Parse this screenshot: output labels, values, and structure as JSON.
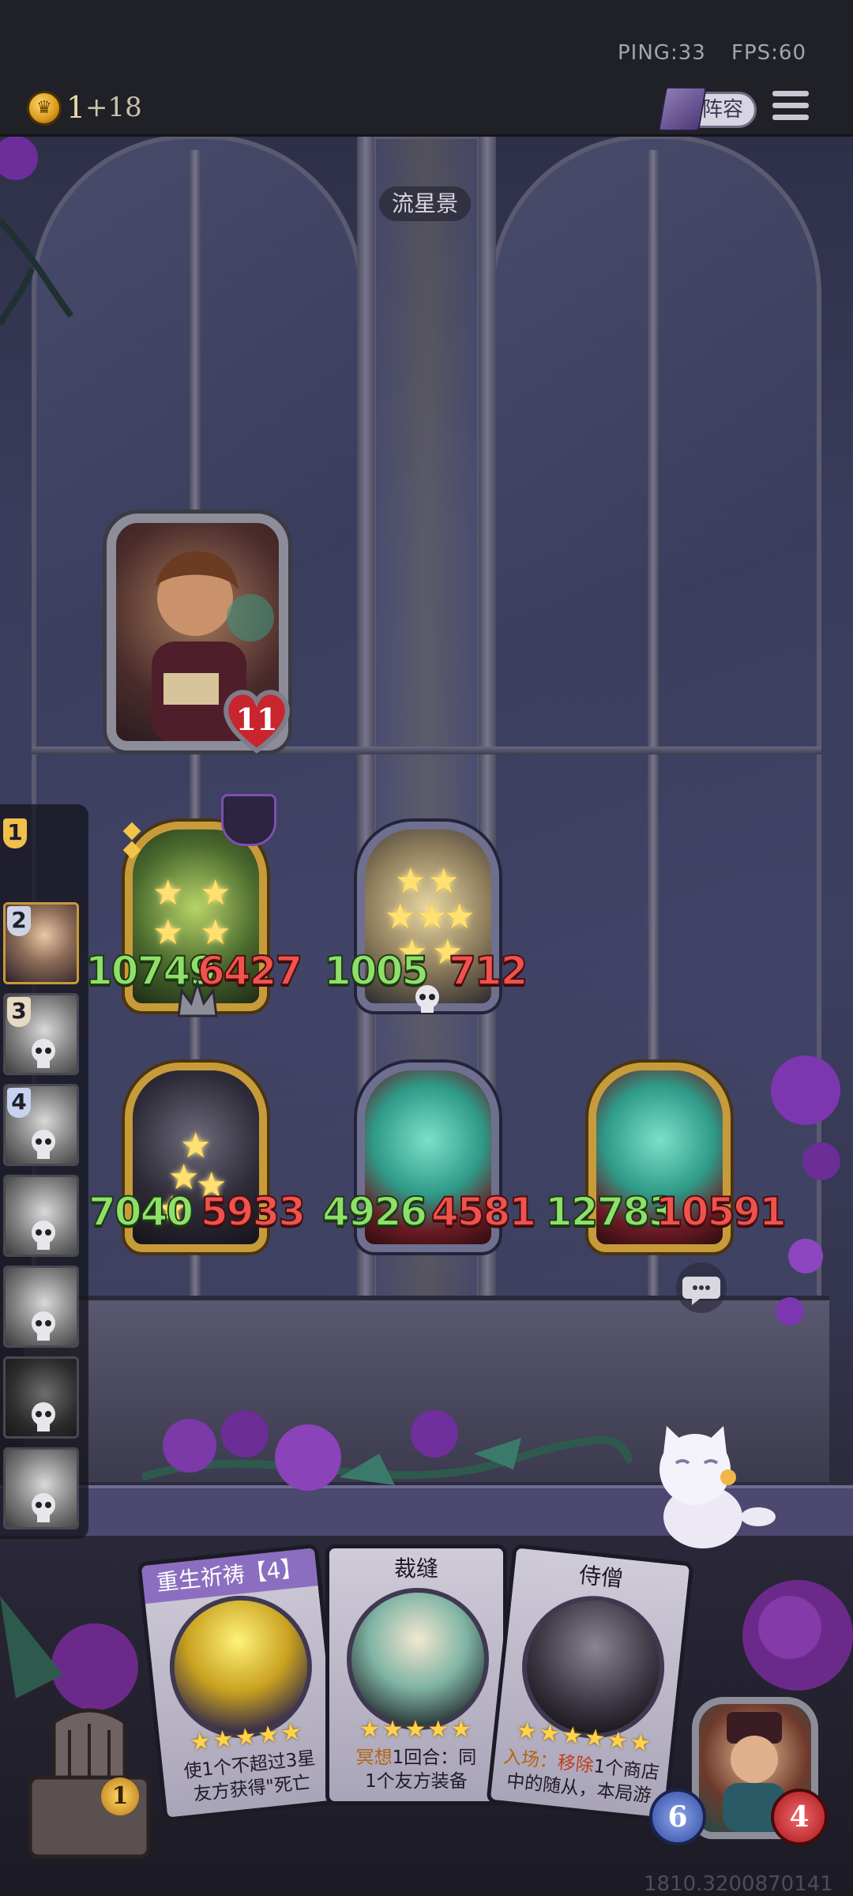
{
  "status": {
    "ping": "PING:33",
    "fps": "FPS:60"
  },
  "resources": {
    "gold": "1",
    "gold_income": "+18"
  },
  "header": {
    "lineup_label": "阵容"
  },
  "board": {
    "location": "流星景"
  },
  "hero": {
    "health": "11"
  },
  "minions": [
    {
      "id": "m1",
      "atk": "10749",
      "hp": "6427",
      "frame": "gold",
      "stars": 4
    },
    {
      "id": "m2",
      "atk": "1005",
      "hp": "712",
      "frame": "silver",
      "stars": 7
    },
    {
      "id": "m3",
      "atk": "7040",
      "hp": "5933",
      "frame": "gold",
      "stars": 4
    },
    {
      "id": "m4",
      "atk": "4926",
      "hp": "4581",
      "frame": "silver",
      "stars": 0
    },
    {
      "id": "m5",
      "atk": "12783",
      "hp": "10591",
      "frame": "gold",
      "stars": 0
    }
  ],
  "opponents": [
    {
      "rank": "1",
      "active": false
    },
    {
      "rank": "2",
      "active": true
    },
    {
      "rank": "3",
      "active": false
    },
    {
      "rank": "4",
      "active": false
    },
    {
      "rank": "",
      "active": false
    },
    {
      "rank": "",
      "active": false
    },
    {
      "rank": "",
      "active": false
    },
    {
      "rank": "",
      "active": false
    }
  ],
  "hand": [
    {
      "title": "重生祈祷【4】",
      "stars": "★★★★★",
      "line1": "使1个不超过3星",
      "line2": "友方获得\"死亡"
    },
    {
      "title": "裁缝",
      "stars": "★★★★★",
      "line1_hl": "冥想",
      "line1": "1回合：同",
      "line2": "1个友方装备"
    },
    {
      "title": "侍僧",
      "stars": "★★★★★★",
      "line1_hl": "入场：",
      "line1_red": "移除",
      "line1": "1个商店",
      "line2": "中的随从，本局游"
    }
  ],
  "shop": {
    "level": "1"
  },
  "player": {
    "armor": "6",
    "health": "4"
  },
  "footer": {
    "id": "1810.3200870141"
  },
  "colors": {
    "gold_frame": "#c89b3a",
    "silver_frame": "#6f6f90",
    "atk": "#8ee06a",
    "hp": "#f0524e"
  }
}
